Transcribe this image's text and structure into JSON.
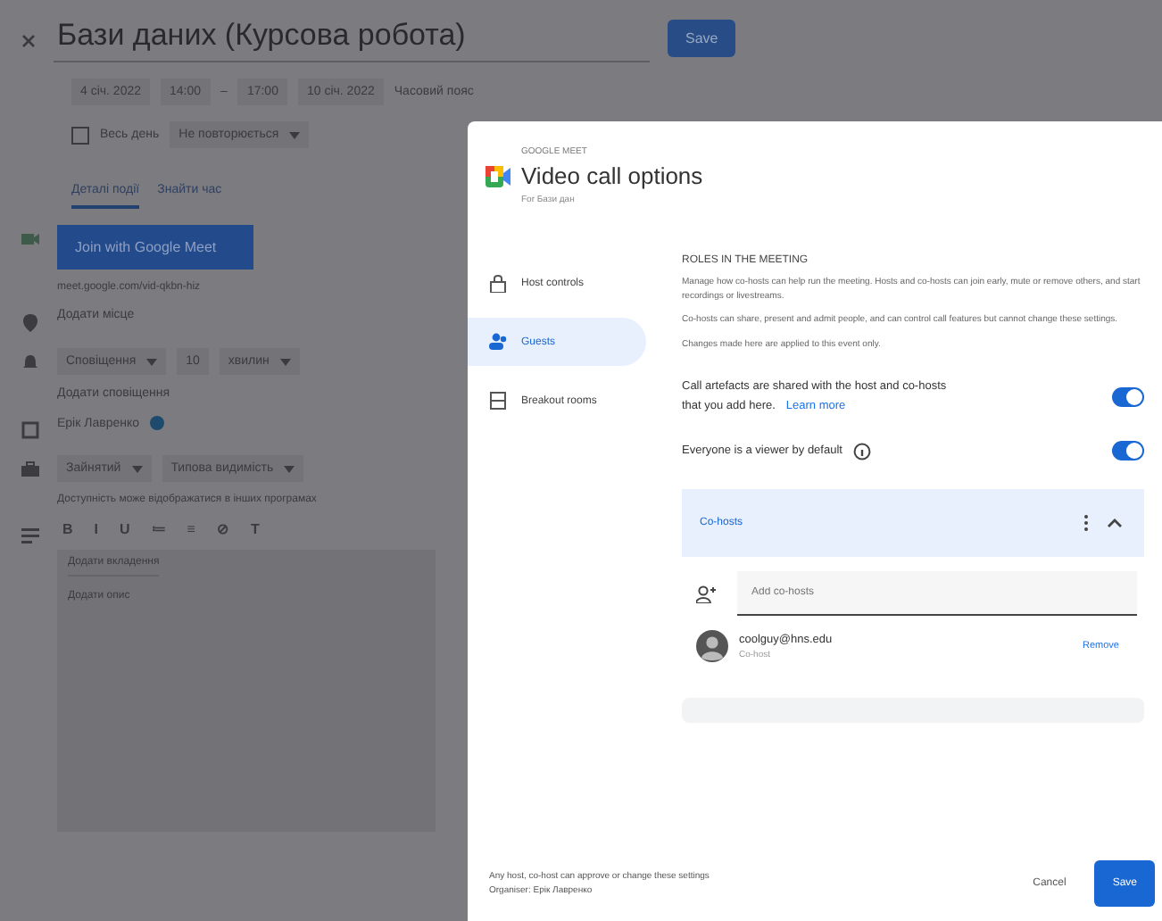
{
  "editor": {
    "title": "Бази даних (Курсова робота)",
    "save": "Save",
    "date_chips": [
      "4 січ. 2022",
      "14:00",
      "–",
      "17:00",
      "10 січ. 2022"
    ],
    "timezone": "Часовий пояс",
    "all_day": {
      "label": "Весь день",
      "checked": false
    },
    "repeat": "Не повторюється",
    "tabs": [
      {
        "label": "Деталі події",
        "selected": true
      },
      {
        "label": "Знайти час",
        "selected": false
      }
    ],
    "meet_button": "Join with Google Meet",
    "meet_note": "meet.google.com/vid-qkbn-hiz",
    "location": "Додати місце",
    "notification": [
      "Сповіщення",
      "10",
      "хвилин"
    ],
    "add_notification": "Додати сповіщення",
    "calendar": "Ерік Лавренко",
    "status": [
      "Зайнятий",
      "Типова видимість"
    ],
    "status_note": "Доступність може відображатися в інших програмах",
    "toolbar": [
      "B",
      "I",
      "U",
      "≔",
      "≡",
      "⊘",
      "T"
    ],
    "attachment": "Додати вкладення",
    "description": "Додати опис"
  },
  "dialog": {
    "eyebrow": "GOOGLE MEET",
    "title": "Video call options",
    "subtitle": "For Бази дан",
    "nav": [
      {
        "label": "Host controls",
        "selected": false
      },
      {
        "label": "Guests",
        "selected": true
      },
      {
        "label": "Breakout rooms",
        "selected": false
      }
    ],
    "heading": "ROLES IN THE MEETING",
    "paragraphs": [
      "Manage how co-hosts can help run the meeting. Hosts and co-hosts can join early, mute or remove others, and start recordings or livestreams.",
      "Co-hosts can share, present and admit people, and can control call features but cannot change these settings.",
      "Changes made here are applied to this event only."
    ],
    "toggles": [
      {
        "label": "Call artefacts are shared with the host and co-hosts",
        "link_line": "that you add here.",
        "link": "Learn more",
        "on": true
      },
      {
        "label": "Everyone is a viewer by default",
        "info": true,
        "on": true
      }
    ],
    "cohosts": {
      "title": "Co-hosts",
      "expanded": true,
      "placeholder": "Add co-hosts",
      "people": [
        {
          "email": "coolguy@hns.edu",
          "role": "Co-host",
          "action": "Remove"
        }
      ]
    },
    "footer": [
      "Any host, co-host can approve or change these settings",
      "Organiser: Ерік Лавренко"
    ],
    "cancel": "Cancel",
    "save": "Save"
  }
}
